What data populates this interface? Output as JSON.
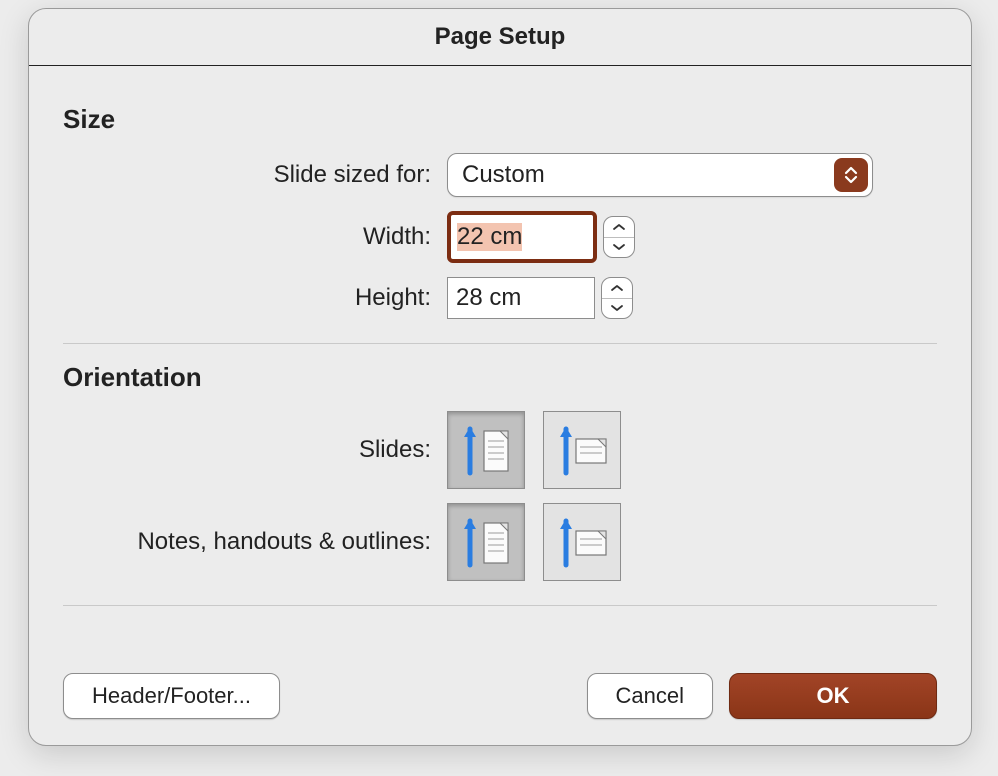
{
  "dialog": {
    "title": "Page Setup"
  },
  "size": {
    "section_label": "Size",
    "sized_for_label": "Slide sized for:",
    "sized_for_value": "Custom",
    "width_label": "Width:",
    "width_value": "22 cm",
    "height_label": "Height:",
    "height_value": "28 cm"
  },
  "orientation": {
    "section_label": "Orientation",
    "slides_label": "Slides:",
    "notes_label": "Notes, handouts & outlines:",
    "slides_selected": "portrait",
    "notes_selected": "portrait"
  },
  "buttons": {
    "header_footer": "Header/Footer...",
    "cancel": "Cancel",
    "ok": "OK"
  }
}
